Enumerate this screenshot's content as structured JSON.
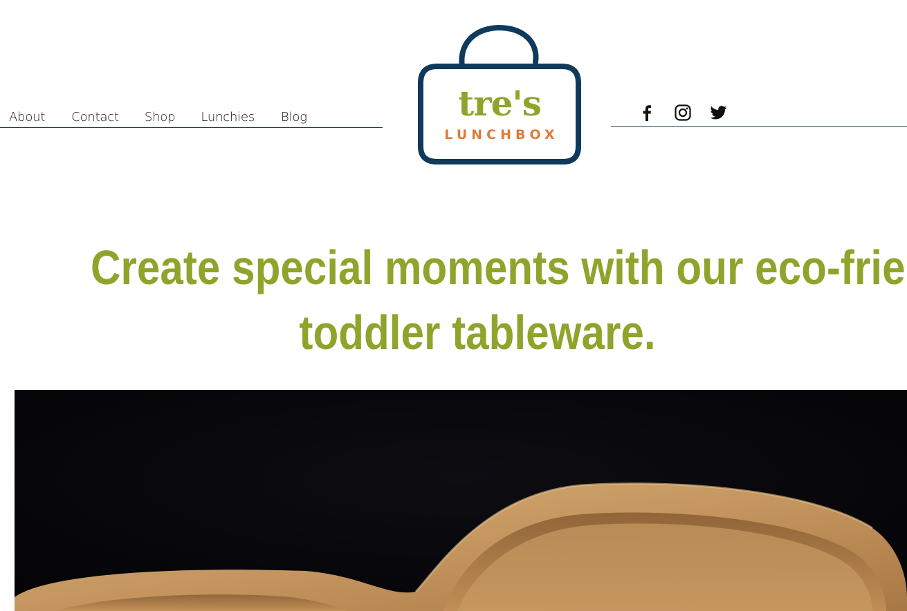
{
  "nav": {
    "items": [
      "About",
      "Contact",
      "Shop",
      "Lunchies",
      "Blog"
    ]
  },
  "logo": {
    "name": "tre's",
    "sub": "LUNCHBOX"
  },
  "social": {
    "icons": [
      "facebook-icon",
      "instagram-icon",
      "twitter-icon"
    ]
  },
  "headline": {
    "line1": "Create special moments with our eco-friendly",
    "line2": "toddler tableware."
  },
  "colors": {
    "green": "#8ea42b",
    "navy": "#0f3a5c",
    "orange": "#e07a3a",
    "rule": "#1c3d5a",
    "hero_bg": "#05050a",
    "wood": "#c99a62"
  }
}
